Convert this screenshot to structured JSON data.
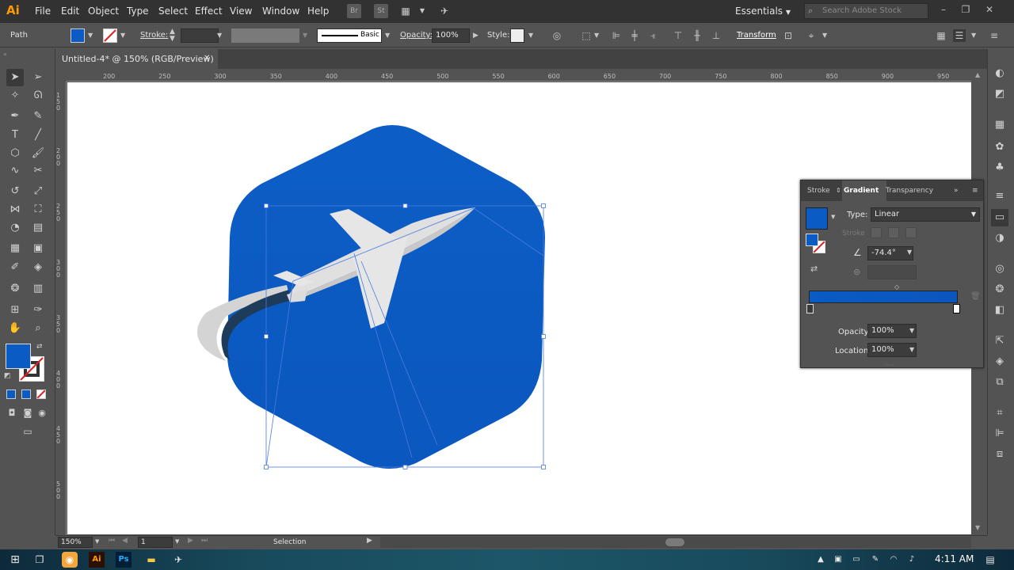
{
  "app": {
    "logo": "Ai",
    "menu": [
      "File",
      "Edit",
      "Object",
      "Type",
      "Select",
      "Effect",
      "View",
      "Window",
      "Help"
    ],
    "bridge_badge": "Br",
    "stock_badge": "St",
    "workspace": "Essentials",
    "search_placeholder": "Search Adobe Stock"
  },
  "controlbar": {
    "object_type": "Path",
    "stroke_label": "Stroke:",
    "brush_label": "Basic",
    "opacity_label": "Opacity:",
    "opacity_value": "100%",
    "style_label": "Style:",
    "transform_label": "Transform"
  },
  "document": {
    "tab_title": "Untitled-4* @ 150% (RGB/Preview)"
  },
  "rulers": {
    "horizontal": [
      "200",
      "250",
      "300",
      "350",
      "400",
      "450",
      "500",
      "550",
      "600",
      "650",
      "700",
      "750",
      "800",
      "850",
      "900",
      "950"
    ],
    "vertical": [
      "150",
      "200",
      "250",
      "300",
      "350",
      "400",
      "450",
      "500"
    ]
  },
  "gradient_panel": {
    "tabs": [
      "Stroke",
      "Gradient",
      "Transparency"
    ],
    "type_label": "Type:",
    "type_value": "Linear",
    "stroke_label": "Stroke",
    "angle_value": "-74.4°",
    "opacity_label": "Opacity:",
    "opacity_value": "100%",
    "location_label": "Location:",
    "location_value": "100%",
    "colors": {
      "start": "#0a5bc4",
      "end": "#0b56bd"
    }
  },
  "statusbar": {
    "zoom": "150%",
    "artboard": "1",
    "tool": "Selection"
  },
  "taskbar": {
    "time": "4:11 AM"
  },
  "colors": {
    "fill": "#0a5bc4",
    "artwork_blue": "#0b5cc2",
    "plane_light": "#e0e0e0",
    "plane_shadow": "#cfcfcf",
    "orbit_dark": "#1e3c5a",
    "selection_line": "#4a7ce0"
  }
}
